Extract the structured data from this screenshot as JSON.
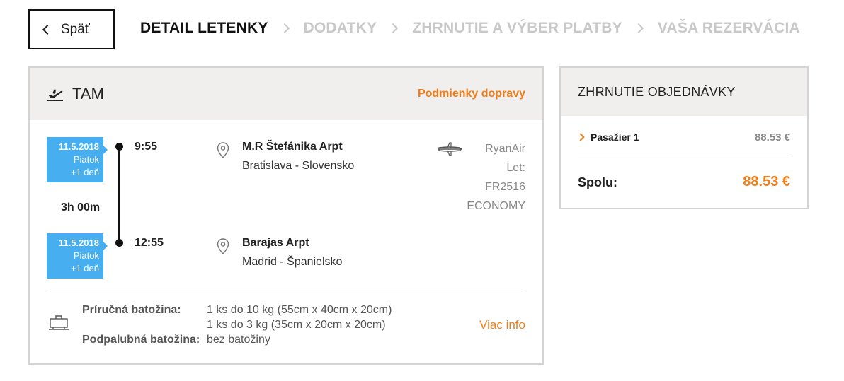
{
  "nav": {
    "back_label": "Späť",
    "steps": [
      {
        "label": "DETAIL LETENKY",
        "active": true
      },
      {
        "label": "DODATKY",
        "active": false
      },
      {
        "label": "ZHRNUTIE A VÝBER PLATBY",
        "active": false
      },
      {
        "label": "VAŠA REZERVÁCIA",
        "active": false
      }
    ]
  },
  "flight": {
    "direction": "TAM",
    "conditions_link": "Podmienky dopravy",
    "departure": {
      "date": "11.5.2018",
      "weekday": "Piatok",
      "day_offset": "+1 deň",
      "time": "9:55",
      "airport": "M.R Štefánika Arpt",
      "city": "Bratislava - Slovensko"
    },
    "duration": "3h 00m",
    "arrival": {
      "date": "11.5.2018",
      "weekday": "Piatok",
      "day_offset": "+1 deň",
      "time": "12:55",
      "airport": "Barajas Arpt",
      "city": "Madrid - Španielsko"
    },
    "carrier": "RyanAir",
    "flight_label": "Let:",
    "flight_number": "FR2516",
    "cabin": "ECONOMY",
    "baggage": {
      "hand_label": "Príručná batožina:",
      "hand_value_1": "1 ks do 10 kg (55cm x 40cm x 20cm)",
      "hand_value_2": "1 ks do 3 kg (35cm x 20cm x 20cm)",
      "hold_label": "Podpalubná batožina:",
      "hold_value": "bez batožiny",
      "more_info": "Viac info"
    }
  },
  "summary": {
    "title": "ZHRNUTIE OBJEDNÁVKY",
    "passenger_label": "Pasažier 1",
    "passenger_price": "88.53 €",
    "total_label": "Spolu:",
    "total_value": "88.53 €"
  },
  "colors": {
    "accent": "#f07c17",
    "badge": "#47aef0",
    "header_bg": "#f1efed"
  }
}
